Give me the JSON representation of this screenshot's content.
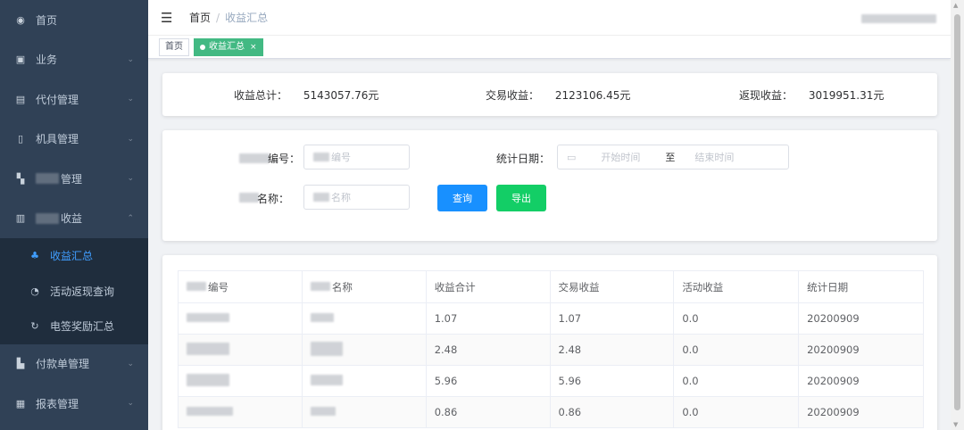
{
  "sidebar": {
    "items": [
      {
        "label": "首页",
        "icon": "dashboard-icon",
        "arrow": ""
      },
      {
        "label": "业务",
        "icon": "briefcase-icon",
        "arrow": "⌄"
      },
      {
        "label": "代付管理",
        "icon": "table-icon",
        "arrow": "⌄"
      },
      {
        "label": "机具管理",
        "icon": "device-icon",
        "arrow": "⌄"
      },
      {
        "label": "管理",
        "icon": "document-icon",
        "arrow": "⌄"
      },
      {
        "label": "收益",
        "icon": "database-icon",
        "arrow": "⌃"
      }
    ],
    "sub_items": [
      {
        "label": "收益汇总",
        "icon": "money-icon"
      },
      {
        "label": "活动返现查询",
        "icon": "refund-icon"
      },
      {
        "label": "电签奖励汇总",
        "icon": "reward-icon"
      }
    ],
    "bottom_items": [
      {
        "label": "付款单管理",
        "icon": "receipt-icon",
        "arrow": "⌄"
      },
      {
        "label": "报表管理",
        "icon": "report-icon",
        "arrow": "⌄"
      }
    ]
  },
  "header": {
    "breadcrumb_home": "首页",
    "breadcrumb_sep": "/",
    "breadcrumb_current": "收益汇总"
  },
  "tags": {
    "home": "首页",
    "current": "收益汇总",
    "close": "×"
  },
  "summary": {
    "total_label": "收益总计：",
    "total_value": "5143057.76元",
    "trade_label": "交易收益：",
    "trade_value": "2123106.45元",
    "cashback_label": "返现收益：",
    "cashback_value": "3019951.31元"
  },
  "filter": {
    "no_label": "编号：",
    "no_placeholder": "编号",
    "name_label": "名称：",
    "name_placeholder": "名称",
    "date_label": "统计日期：",
    "date_start_placeholder": "开始时间",
    "date_separator": "至",
    "date_end_placeholder": "结束时间",
    "query_button": "查询",
    "export_button": "导出"
  },
  "table": {
    "headers": [
      "编号",
      "名称",
      "收益合计",
      "交易收益",
      "活动收益",
      "统计日期"
    ],
    "rows": [
      {
        "total": "1.07",
        "trade": "1.07",
        "activity": "0.0",
        "date": "20200909"
      },
      {
        "total": "2.48",
        "trade": "2.48",
        "activity": "0.0",
        "date": "20200909"
      },
      {
        "total": "5.96",
        "trade": "5.96",
        "activity": "0.0",
        "date": "20200909"
      },
      {
        "total": "0.86",
        "trade": "0.86",
        "activity": "0.0",
        "date": "20200909"
      }
    ]
  },
  "colors": {
    "sidebar_bg": "#304156",
    "submenu_bg": "#1f2d3d",
    "active_link": "#409eff",
    "tag_active": "#42b983",
    "query_button": "#1890ff",
    "export_button": "#13ce66"
  }
}
